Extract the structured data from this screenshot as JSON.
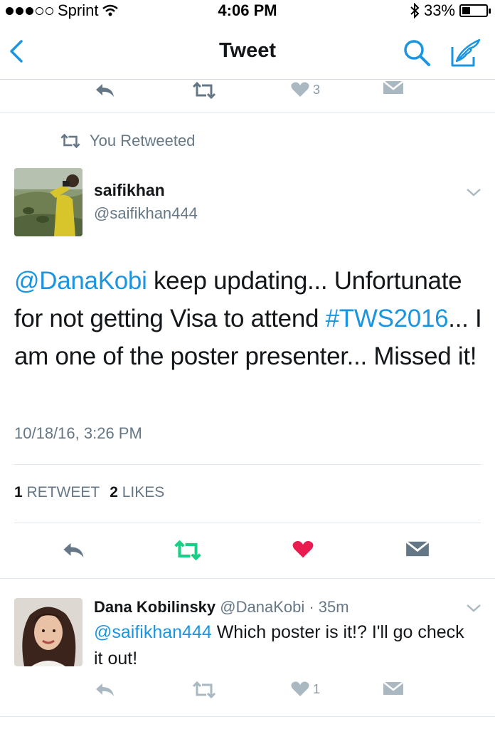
{
  "status_bar": {
    "carrier": "Sprint",
    "time": "4:06 PM",
    "battery": "33%",
    "battery_level": 0.33
  },
  "nav": {
    "title": "Tweet"
  },
  "prev_tweet_actions": {
    "like_count": "3"
  },
  "retweet_context": {
    "label": "You Retweeted"
  },
  "tweet": {
    "author_name": "saifikhan",
    "author_handle": "@saifikhan444",
    "text_mention": "@DanaKobi",
    "text_part1": " keep updating... Unfortunate for not getting Visa to attend ",
    "text_hashtag": "#TWS2016",
    "text_part2": "... I am one of the poster presenter... Missed it!",
    "timestamp": "10/18/16, 3:26 PM",
    "retweet_count": "1",
    "retweet_label": "RETWEET",
    "like_count": "2",
    "like_label": "LIKES",
    "colors": {
      "retweet_active": "#19cf86",
      "like_active": "#e81c4f",
      "link": "#1b95e0"
    }
  },
  "reply": {
    "author_name": "Dana Kobilinsky",
    "meta": "@DanaKobi · 35m",
    "text_mention": "@saifikhan444",
    "text": " Which poster is it!? I'll go check it out!",
    "like_count": "1"
  }
}
